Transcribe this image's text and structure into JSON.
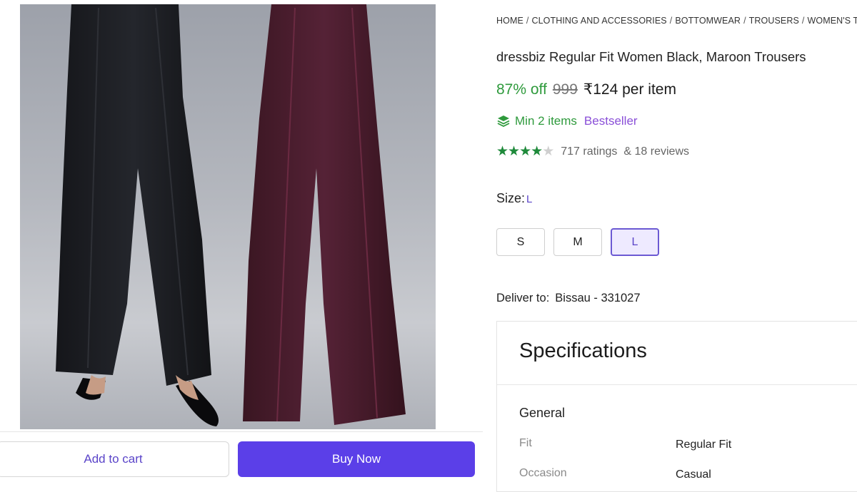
{
  "breadcrumb": [
    "HOME",
    "CLOTHING AND ACCESSORIES",
    "BOTTOMWEAR",
    "TROUSERS",
    "WOMEN'S TROUSERS"
  ],
  "product": {
    "title": "dressbiz Regular Fit Women Black, Maroon Trousers",
    "discount": "87% off",
    "mrp": "999",
    "price": "₹124 per item",
    "min_items": "Min 2 items",
    "badge": "Bestseller",
    "rating": 4,
    "rating_max": 5,
    "ratings_text": "717 ratings",
    "reviews_text": "& 18 reviews"
  },
  "size": {
    "label": "Size:",
    "selected": "L",
    "options": [
      "S",
      "M",
      "L"
    ]
  },
  "delivery": {
    "label": "Deliver to:",
    "location": "Bissau - 331027"
  },
  "specifications": {
    "title": "Specifications",
    "group": "General",
    "rows": [
      {
        "key": "Fit",
        "value": "Regular Fit"
      },
      {
        "key": "Occasion",
        "value": "Casual"
      }
    ]
  },
  "actions": {
    "add_to_cart": "Add to cart",
    "buy_now": "Buy Now"
  },
  "colors": {
    "accent": "#5b3fe8",
    "discount_green": "#2e9a3c",
    "bestseller_purple": "#8a4fd8",
    "star_green": "#1f8a3b"
  },
  "icons": {
    "offer": "layers-icon"
  }
}
